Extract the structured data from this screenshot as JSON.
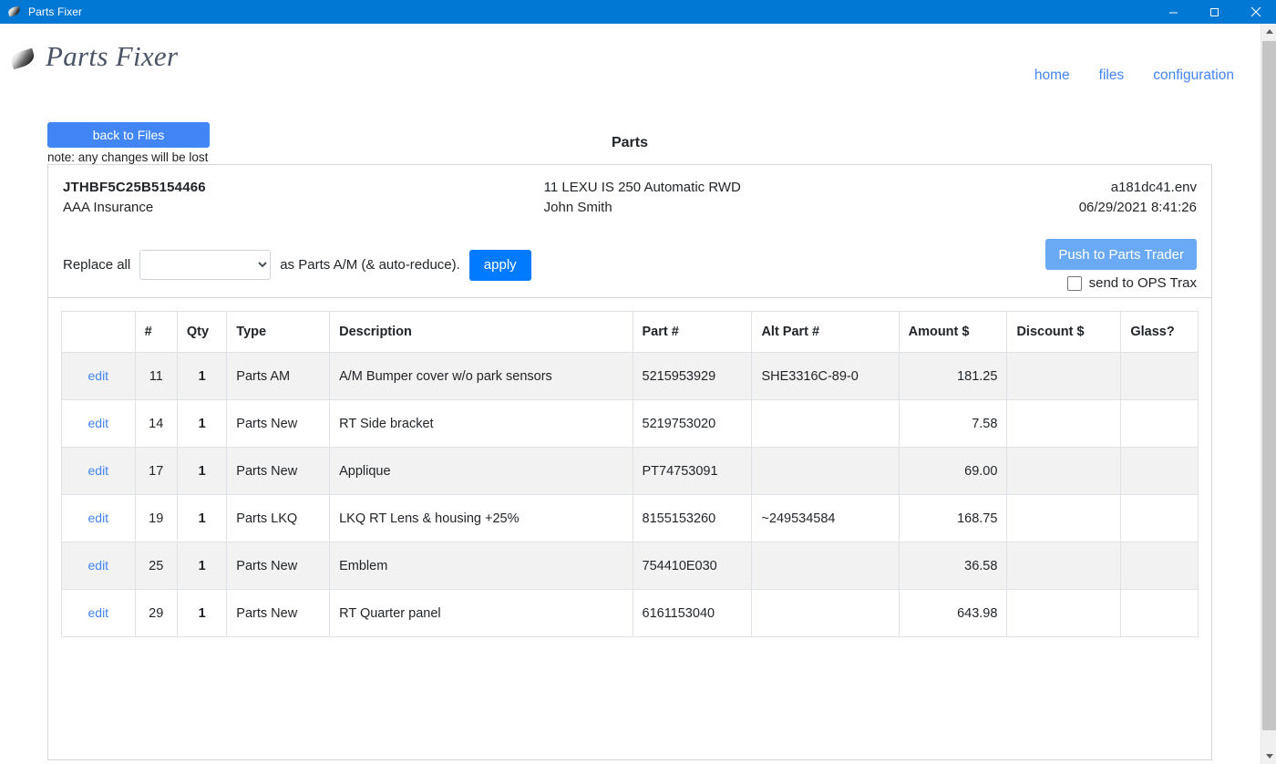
{
  "window": {
    "title": "Parts Fixer",
    "icon": "feather-icon",
    "controls": {
      "minimize": "minimize-icon",
      "maximize": "maximize-icon",
      "close": "close-icon"
    }
  },
  "brand": {
    "name": "Parts Fixer",
    "icon": "feather-icon"
  },
  "nav": {
    "items": [
      {
        "label": "home"
      },
      {
        "label": "files"
      },
      {
        "label": "configuration"
      }
    ]
  },
  "actions": {
    "back_label": "back to Files",
    "note": "note: any changes will be lost",
    "page_title": "Parts"
  },
  "info": {
    "vin": "JTHBF5C25B5154466",
    "insurer": "AAA Insurance",
    "vehicle": "11 LEXU IS 250 Automatic RWD",
    "owner": "John Smith",
    "file": "a181dc41.env",
    "timestamp": "06/29/2021 8:41:26"
  },
  "controls": {
    "replace_label": "Replace all",
    "select_value": "",
    "select_options": [
      ""
    ],
    "as_label": "as Parts A/M (& auto-reduce).",
    "apply_label": "apply",
    "push_label": "Push to Parts Trader",
    "ops_trax_label": "send to OPS Trax",
    "ops_trax_checked": false
  },
  "table": {
    "columns": [
      "",
      "#",
      "Qty",
      "Type",
      "Description",
      "Part #",
      "Alt Part #",
      "Amount $",
      "Discount $",
      "Glass?"
    ],
    "edit_label": "edit",
    "rows": [
      {
        "edit": "edit",
        "num": "11",
        "qty": "1",
        "type": "Parts AM",
        "description": "A/M Bumper cover w/o park sensors",
        "part": "5215953929",
        "alt_part": "SHE3316C-89-0",
        "amount": "181.25",
        "discount": "",
        "glass": ""
      },
      {
        "edit": "edit",
        "num": "14",
        "qty": "1",
        "type": "Parts New",
        "description": "RT Side bracket",
        "part": "5219753020",
        "alt_part": "",
        "amount": "7.58",
        "discount": "",
        "glass": ""
      },
      {
        "edit": "edit",
        "num": "17",
        "qty": "1",
        "type": "Parts New",
        "description": "Applique",
        "part": "PT74753091",
        "alt_part": "",
        "amount": "69.00",
        "discount": "",
        "glass": ""
      },
      {
        "edit": "edit",
        "num": "19",
        "qty": "1",
        "type": "Parts LKQ",
        "description": "LKQ RT Lens & housing +25%",
        "part": "8155153260",
        "alt_part": "~249534584",
        "amount": "168.75",
        "discount": "",
        "glass": ""
      },
      {
        "edit": "edit",
        "num": "25",
        "qty": "1",
        "type": "Parts New",
        "description": "Emblem",
        "part": "754410E030",
        "alt_part": "",
        "amount": "36.58",
        "discount": "",
        "glass": ""
      },
      {
        "edit": "edit",
        "num": "29",
        "qty": "1",
        "type": "Parts New",
        "description": "RT Quarter panel",
        "part": "6161153040",
        "alt_part": "",
        "amount": "643.98",
        "discount": "",
        "glass": ""
      }
    ]
  },
  "colors": {
    "titlebar": "#0078d4",
    "primary_button": "#4285f4",
    "apply_button": "#007bff",
    "push_button": "#6aa9f4",
    "link": "#4285f4",
    "row_alt": "#f2f2f2"
  }
}
